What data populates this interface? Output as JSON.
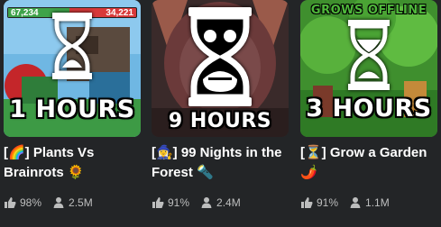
{
  "colors": {
    "background": "#232527",
    "title_text": "#ffffff",
    "stat_text": "#bdbebe"
  },
  "games": [
    {
      "title": "[🌈] Plants Vs Brainrots 🌻",
      "timer": "1 HOURS",
      "top_bar_left": "67,234",
      "top_bar_right": "34,221",
      "rating": "98%",
      "players": "2.5M",
      "icons": {
        "rating": "thumbs-up-icon",
        "players": "person-icon",
        "badge": "hourglass-icon"
      }
    },
    {
      "title": "[🧙‍♀️] 99 Nights in the Forest 🔦",
      "timer": "9 HOURS",
      "rating": "91%",
      "players": "2.4M",
      "icons": {
        "rating": "thumbs-up-icon",
        "players": "person-icon",
        "badge": "hourglass-icon"
      }
    },
    {
      "title": "[⏳] Grow a Garden 🌶️",
      "timer": "3 HOURS",
      "banner": "GROWS OFFLINE",
      "rating": "91%",
      "players": "1.1M",
      "icons": {
        "rating": "thumbs-up-icon",
        "players": "person-icon",
        "badge": "hourglass-icon"
      }
    }
  ]
}
